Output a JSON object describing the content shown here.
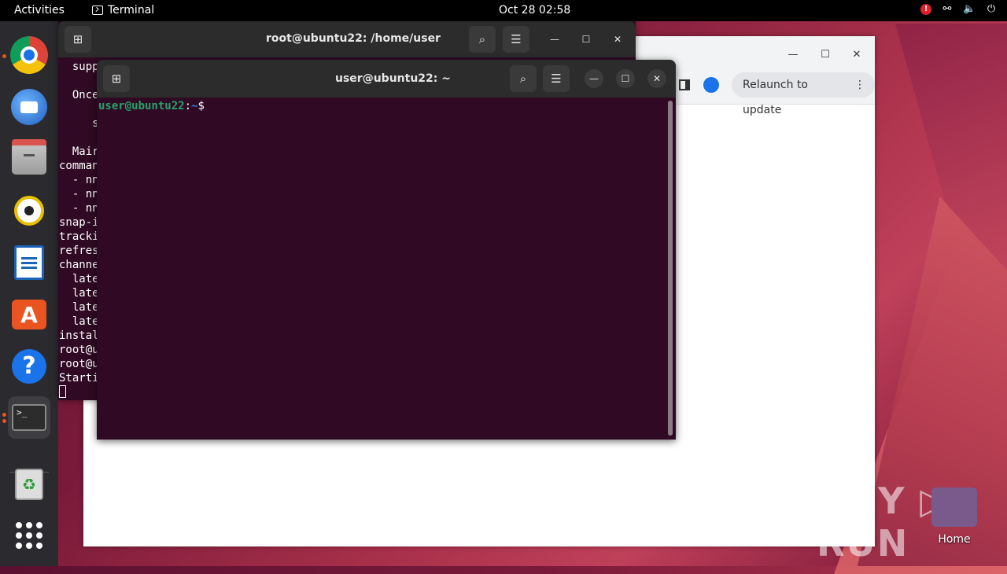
{
  "topbar": {
    "activities": "Activities",
    "app_name": "Terminal",
    "clock": "Oct 28  02:58",
    "alert_badge": "!"
  },
  "dock": {
    "items": [
      {
        "name": "chrome-icon",
        "running": true
      },
      {
        "name": "thunderbird-icon",
        "running": false
      },
      {
        "name": "files-icon",
        "running": false
      },
      {
        "name": "rhythmbox-icon",
        "running": false
      },
      {
        "name": "libreoffice-writer-icon",
        "running": false
      },
      {
        "name": "app-center-icon",
        "running": false
      },
      {
        "name": "help-icon",
        "running": false
      },
      {
        "name": "terminal-icon",
        "running": true
      },
      {
        "name": "trash-icon",
        "running": false
      },
      {
        "name": "show-apps-icon",
        "running": false
      }
    ],
    "app_center_glyph": "A",
    "help_glyph": "?",
    "terminal_glyph": ">_",
    "trash_glyph": "♻"
  },
  "browser": {
    "relaunch_label": "Relaunch to update",
    "relaunch_menu": "⋮"
  },
  "back_terminal": {
    "title": "root@ubuntu22: /home/user",
    "lines": [
      "  supp",
      "",
      "  Once",
      "",
      "     s",
      "",
      "  Mair",
      "comman",
      "  - nn",
      "  - nn",
      "  - nn",
      "snap-i",
      "tracki",
      "refres",
      "channe",
      "  late",
      "  late",
      "  late",
      "  late",
      "instal",
      "root@u",
      "root@u",
      "Starti"
    ]
  },
  "front_terminal": {
    "title": "user@ubuntu22: ~",
    "prompt_user": "user@ubuntu22",
    "prompt_sep": ":",
    "prompt_path": "~",
    "prompt_symbol": "$"
  },
  "desktop": {
    "home_label": "Home",
    "watermark": "ANY ▷ RUN"
  }
}
